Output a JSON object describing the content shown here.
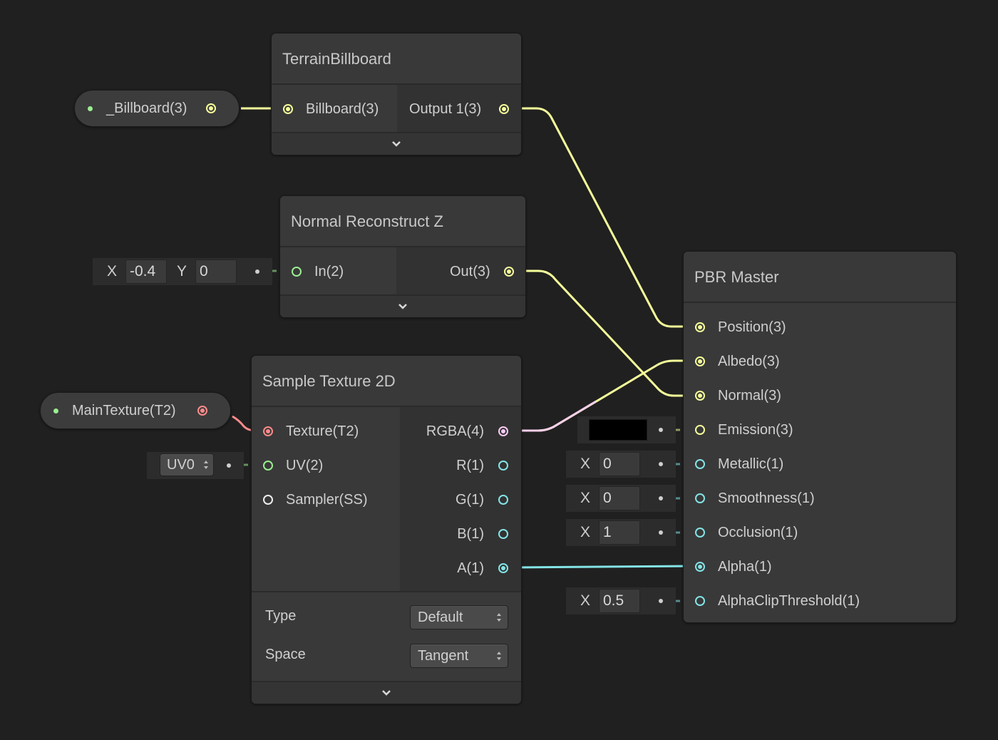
{
  "colors": {
    "vector3": "#f6ff9a",
    "vector2": "#9aef92",
    "vector1": "#84e4e7",
    "vector4": "#fbcbf4",
    "texture": "#ff8b8b",
    "sampler": "#ffffff",
    "background": "#202020"
  },
  "properties": {
    "billboard": {
      "label": "_Billboard(3)"
    },
    "main_texture": {
      "label": "MainTexture(T2)"
    }
  },
  "terrain_billboard": {
    "title": "TerrainBillboard",
    "input_label": "Billboard(3)",
    "output_label": "Output 1(3)"
  },
  "normal_reconstruct": {
    "title": "Normal Reconstruct Z",
    "input_label": "In(2)",
    "output_label": "Out(3)",
    "default_x_axis": "X",
    "default_x_value": "-0.4",
    "default_y_axis": "Y",
    "default_y_value": "0"
  },
  "sample_texture": {
    "title": "Sample Texture 2D",
    "inputs": [
      "Texture(T2)",
      "UV(2)",
      "Sampler(SS)"
    ],
    "outputs": [
      "RGBA(4)",
      "R(1)",
      "G(1)",
      "B(1)",
      "A(1)"
    ],
    "uv_default": "UV0",
    "type_label": "Type",
    "type_value": "Default",
    "space_label": "Space",
    "space_value": "Tangent"
  },
  "pbr_master": {
    "title": "PBR Master",
    "inputs": [
      "Position(3)",
      "Albedo(3)",
      "Normal(3)",
      "Emission(3)",
      "Metallic(1)",
      "Smoothness(1)",
      "Occlusion(1)",
      "Alpha(1)",
      "AlphaClipThreshold(1)"
    ],
    "emission_color": "#000000",
    "metallic_axis": "X",
    "metallic_value": "0",
    "smoothness_axis": "X",
    "smoothness_value": "0",
    "occlusion_axis": "X",
    "occlusion_value": "1",
    "clip_axis": "X",
    "clip_value": "0.5"
  }
}
